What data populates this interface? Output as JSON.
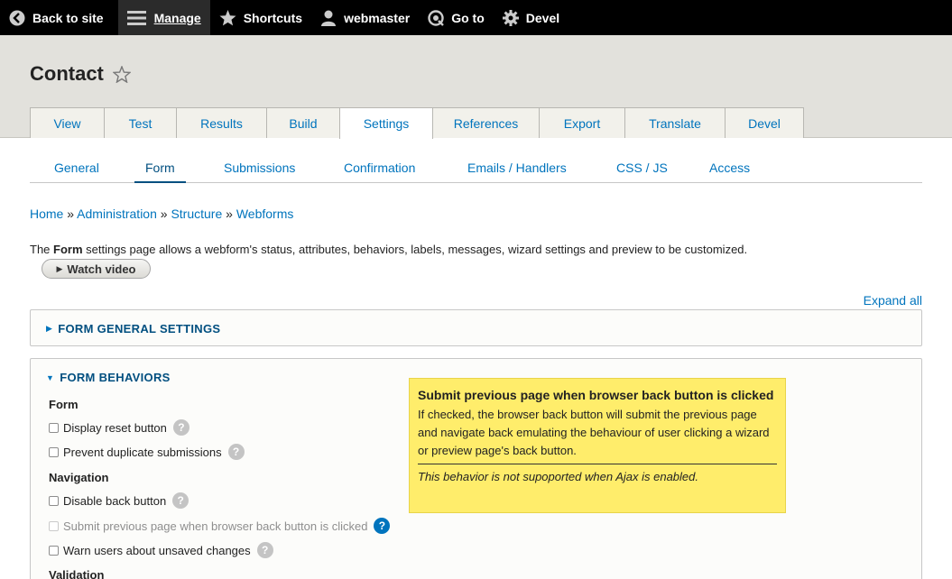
{
  "toolbar": {
    "back": "Back to site",
    "manage": "Manage",
    "shortcuts": "Shortcuts",
    "user": "webmaster",
    "goto": "Go to",
    "devel": "Devel"
  },
  "page": {
    "title": "Contact"
  },
  "tabs": [
    "View",
    "Test",
    "Results",
    "Build",
    "Settings",
    "References",
    "Export",
    "Translate",
    "Devel"
  ],
  "active_tab": "Settings",
  "subtabs": [
    "General",
    "Form",
    "Submissions",
    "Confirmation",
    "Emails / Handlers",
    "CSS / JS",
    "Access"
  ],
  "active_subtab": "Form",
  "breadcrumb": {
    "home": "Home",
    "admin": "Administration",
    "structure": "Structure",
    "webforms": "Webforms",
    "sep": "»"
  },
  "description": {
    "pre": "The ",
    "bold": "Form",
    "post": " settings page allows a webform's status, attributes, behaviors, labels, messages, wizard settings and preview to be customized."
  },
  "watch_video": "Watch video",
  "expand_all": "Expand all",
  "sections": {
    "general": "FORM GENERAL SETTINGS",
    "behaviors": "FORM BEHAVIORS"
  },
  "behaviors": {
    "form_label": "Form",
    "display_reset": "Display reset button",
    "prevent_duplicate": "Prevent duplicate submissions",
    "navigation_label": "Navigation",
    "disable_back": "Disable back button",
    "submit_previous": "Submit previous page when browser back button is clicked",
    "warn_unsaved": "Warn users about unsaved changes",
    "validation_label": "Validation"
  },
  "tooltip": {
    "title": "Submit previous page when browser back button is clicked",
    "body": "If checked, the browser back button will submit the previous page and navigate back emulating the behaviour of user clicking a wizard or preview page's back button.",
    "note": "This behavior is not supoported when Ajax is enabled."
  },
  "help_glyph": "?"
}
